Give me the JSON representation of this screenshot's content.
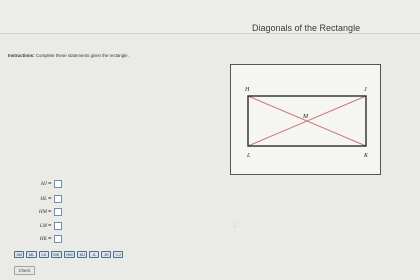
{
  "header": {
    "title": "Diagonals of the Rectangle"
  },
  "instructions": {
    "label": "Instructions:",
    "text": "Complete these statements given the rectangle."
  },
  "figure": {
    "vertices": {
      "H": "H",
      "J": "J",
      "K": "K",
      "L": "L",
      "M": "M"
    },
    "colors": {
      "rectangle": "#2b2b2b",
      "diagonals": "#d0747c"
    }
  },
  "statements": [
    {
      "label": "HJ",
      "sign": "=",
      "value": ""
    },
    {
      "label": "HL",
      "sign": "=",
      "value": ""
    },
    {
      "label": "HM",
      "sign": "=",
      "value": ""
    },
    {
      "label": "LM",
      "sign": "=",
      "value": ""
    },
    {
      "label": "HK",
      "sign": "=",
      "value": ""
    }
  ],
  "choices": [
    "JM",
    "ML",
    "LK",
    "MK",
    "HM",
    "MJ",
    "JL",
    "JK",
    "LJ"
  ],
  "check_button": {
    "label": "Check"
  }
}
